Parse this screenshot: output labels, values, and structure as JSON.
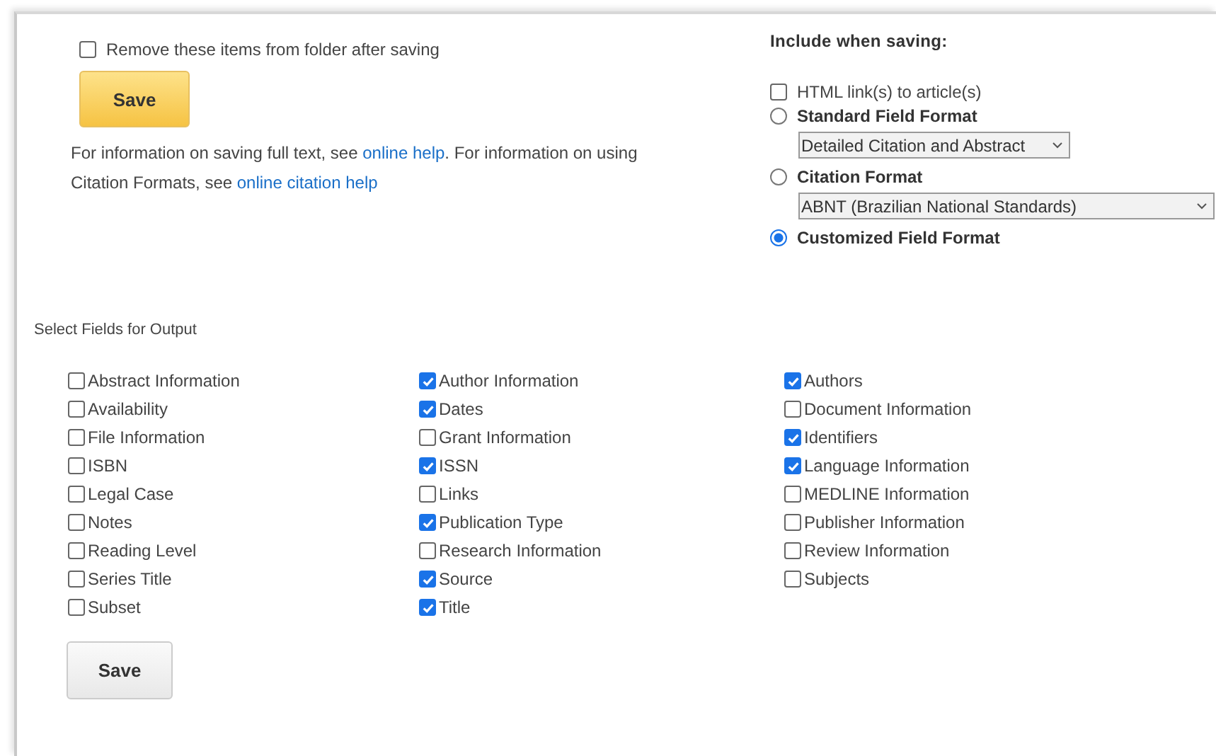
{
  "remove_option": {
    "label": "Remove these items from folder after saving",
    "checked": false
  },
  "top_save": {
    "label": "Save"
  },
  "help": {
    "parts": [
      {
        "kind": "text",
        "text": "For information on saving full text, see "
      },
      {
        "kind": "link",
        "text": "online help"
      },
      {
        "kind": "text",
        "text": ". For information on using Citation Formats, see "
      },
      {
        "kind": "link",
        "text": "online citation help"
      }
    ]
  },
  "include": {
    "heading": "Include when saving:",
    "html_links": {
      "label": "HTML link(s) to article(s)",
      "checked": false
    },
    "formats": [
      {
        "label": "Standard Field Format",
        "selected": false,
        "select": {
          "value": "Detailed Citation and Abstract",
          "wide": false
        }
      },
      {
        "label": "Citation Format",
        "selected": false,
        "select": {
          "value": "ABNT (Brazilian National Standards)",
          "wide": true
        }
      },
      {
        "label": "Customized Field Format",
        "selected": true
      }
    ]
  },
  "fields_heading": "Select Fields for Output",
  "field_columns": [
    [
      {
        "label": "Abstract Information",
        "checked": false
      },
      {
        "label": "Availability",
        "checked": false
      },
      {
        "label": "File Information",
        "checked": false
      },
      {
        "label": "ISBN",
        "checked": false
      },
      {
        "label": "Legal Case",
        "checked": false
      },
      {
        "label": "Notes",
        "checked": false
      },
      {
        "label": "Reading Level",
        "checked": false
      },
      {
        "label": "Series Title",
        "checked": false
      },
      {
        "label": "Subset",
        "checked": false
      }
    ],
    [
      {
        "label": "Author Information",
        "checked": true
      },
      {
        "label": "Dates",
        "checked": true
      },
      {
        "label": "Grant Information",
        "checked": false
      },
      {
        "label": "ISSN",
        "checked": true
      },
      {
        "label": "Links",
        "checked": false
      },
      {
        "label": "Publication Type",
        "checked": true
      },
      {
        "label": "Research Information",
        "checked": false
      },
      {
        "label": "Source",
        "checked": true
      },
      {
        "label": "Title",
        "checked": true
      }
    ],
    [
      {
        "label": "Authors",
        "checked": true
      },
      {
        "label": "Document Information",
        "checked": false
      },
      {
        "label": "Identifiers",
        "checked": true
      },
      {
        "label": "Language Information",
        "checked": true
      },
      {
        "label": "MEDLINE Information",
        "checked": false
      },
      {
        "label": "Publisher Information",
        "checked": false
      },
      {
        "label": "Review Information",
        "checked": false
      },
      {
        "label": "Subjects",
        "checked": false
      }
    ]
  ],
  "bottom_save": {
    "label": "Save"
  }
}
